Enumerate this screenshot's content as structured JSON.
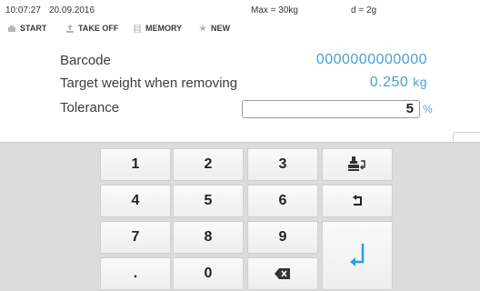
{
  "status": {
    "time": "10:07:27",
    "date": "20.09.2016",
    "max": "Max = 30kg",
    "d": "d = 2g"
  },
  "toolbar": {
    "start": "START",
    "takeoff": "TAKE OFF",
    "memory": "MEMORY",
    "new": "NEW"
  },
  "fields": {
    "barcode_label": "Barcode",
    "barcode_value": "0000000000000",
    "target_label": "Target weight when removing",
    "target_value": "0.250",
    "target_unit": "kg",
    "tolerance_label": "Tolerance",
    "tolerance_value": "5",
    "tolerance_unit": "%"
  },
  "keypad": {
    "k1": "1",
    "k2": "2",
    "k3": "3",
    "k4": "4",
    "k5": "5",
    "k6": "6",
    "k7": "7",
    "k8": "8",
    "k9": "9",
    "kdot": ".",
    "k0": "0"
  },
  "colors": {
    "accent": "#4aa0d6",
    "enter": "#2e9be0",
    "keypad_bg": "#dcdcdc"
  },
  "icons": {
    "print": "print-scale-icon",
    "undo": "undo-icon",
    "backspace": "backspace-icon",
    "enter": "enter-icon"
  }
}
